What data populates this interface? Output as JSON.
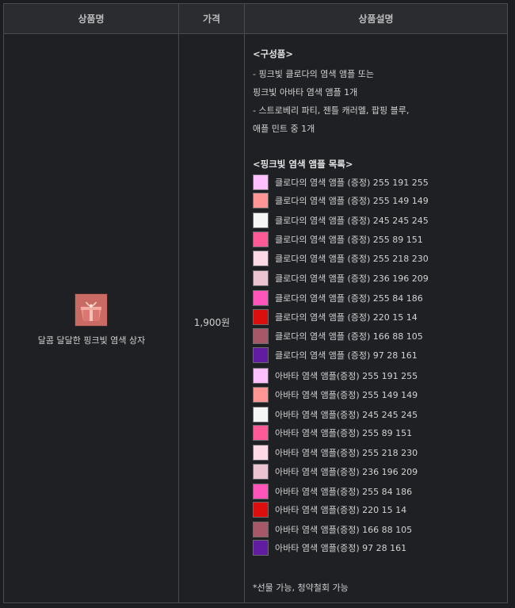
{
  "header": {
    "col_name": "상품명",
    "col_price": "가격",
    "col_desc": "상품설명"
  },
  "product": {
    "icon": "pink-gift-box-icon",
    "name": "달콤 달달한 핑크빛 염색 상자",
    "price": "1,900원"
  },
  "description": {
    "contents_title": "<구성품>",
    "contents_lines": [
      "- 핑크빛 클로다의 염색 앰플 또는",
      " 핑크빛 아바타 염색 앰플 1개",
      "- 스트로베리 파티, 젠틀 캐러멜, 팝핑 블루,",
      "애플 민트 중 1개"
    ],
    "list_title": "<핑크빛 염색 앰플 목록>",
    "ampoules": [
      {
        "label": "클로다의 염색 앰플 (증정) 255 191 255",
        "color": "#ffbfff"
      },
      {
        "label": "클로다의 염색 앰플 (증정) 255 149 149",
        "color": "#ff9595"
      },
      {
        "label": "클로다의 염색 앰플 (증정) 245 245 245",
        "color": "#f5f5f5"
      },
      {
        "label": "클로다의 염색 앰플 (증정) 255 89 151",
        "color": "#ff5997"
      },
      {
        "label": "클로다의 염색 앰플 (증정) 255 218 230",
        "color": "#ffdae6"
      },
      {
        "label": "클로다의 염색 앰플 (증정) 236 196 209",
        "color": "#ecc4d1"
      },
      {
        "label": "클로다의 염색 앰플 (증정) 255 84 186",
        "color": "#ff54ba"
      },
      {
        "label": "클로다의 염색 앰플 (증정) 220 15 14",
        "color": "#dc0f0e"
      },
      {
        "label": "클로다의 염색 앰플 (증정) 166 88 105",
        "color": "#a65869"
      },
      {
        "label": "클로다의 염색 앰플 (증정) 97 28 161",
        "color": "#611ca1"
      },
      {
        "label": "아바타 염색 앰플(증정) 255 191 255",
        "color": "#ffbfff"
      },
      {
        "label": "아바타 염색 앰플(증정) 255 149 149",
        "color": "#ff9595"
      },
      {
        "label": "아바타 염색 앰플(증정) 245 245 245",
        "color": "#f5f5f5"
      },
      {
        "label": "아바타 염색 앰플(증정) 255 89 151",
        "color": "#ff5997"
      },
      {
        "label": "아바타 염색 앰플(증정) 255 218 230",
        "color": "#ffdae6"
      },
      {
        "label": "아바타 염색 앰플(증정) 236 196 209",
        "color": "#ecc4d1"
      },
      {
        "label": "아바타 염색 앰플(증정) 255 84 186",
        "color": "#ff54ba"
      },
      {
        "label": "아바타 염색 앰플(증정) 220 15 14",
        "color": "#dc0f0e"
      },
      {
        "label": "아바타 염색 앰플(증정) 166 88 105",
        "color": "#a65869"
      },
      {
        "label": "아바타 염색 앰플(증정) 97 28 161",
        "color": "#611ca1"
      }
    ],
    "footnote": "*선물 가능, 청약철회 가능"
  }
}
